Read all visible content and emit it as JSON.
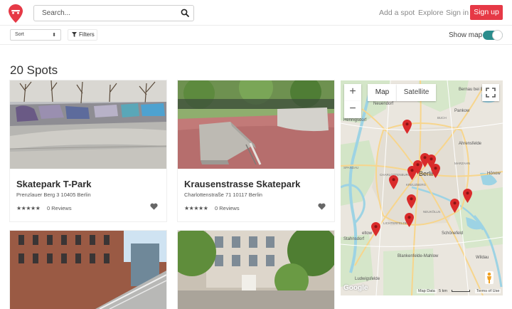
{
  "header": {
    "search_placeholder": "Search...",
    "links": [
      "Add a spot",
      "Explore",
      "Sign in"
    ],
    "signup_label": "Sign up"
  },
  "toolbar": {
    "sort_label": "Sort",
    "filters_label": "Filters",
    "show_map_label": "Show map",
    "show_map_on": true
  },
  "results": {
    "title": "20 Spots"
  },
  "cards": [
    {
      "title": "Skatepark T-Park",
      "address": "Prenzlauer Berg 3 10405 Berlin",
      "reviews": "0 Reviews"
    },
    {
      "title": "Krausenstrasse Skatepark",
      "address": "Charlottenstraße 71 10117 Berlin",
      "reviews": "0 Reviews"
    }
  ],
  "map": {
    "type_map": "Map",
    "type_satellite": "Satellite",
    "zoom_in": "+",
    "zoom_out": "−",
    "places": {
      "bernau": "Bernau bei Berlin",
      "neuendorf": "Neuendorf",
      "hennigsdorf": "Hennigsdorf",
      "pankow": "Pankow",
      "ahrensfelde": "Ahrensfelde",
      "berlin": "Berlin",
      "spandau": "SPANDAU",
      "charlottenburg": "CHARLOTTENBURG",
      "kreuzberg": "KREUZBERG",
      "marzahn": "MARZAHN",
      "hoenow": "Hönow",
      "neukoelln": "NEUKÖLLN",
      "lichterfelde": "LICHTERFELDE",
      "stahnsdorf": "Stahnsdorf",
      "schoenefeld": "Schönefeld",
      "blankenfelde": "Blankenfelde-Mahlow",
      "ludwigsfelde": "Ludwigsfelde",
      "wildau": "Wildau",
      "teltow": "eltow",
      "buch": "BUCH"
    },
    "footer": {
      "logo": "Google",
      "data": "Map Data",
      "scale": "5 km",
      "terms": "Terms of Use"
    },
    "colors": {
      "marker": "#d92b2b",
      "water": "#8fcfe0",
      "park": "#cfe6c4"
    }
  }
}
